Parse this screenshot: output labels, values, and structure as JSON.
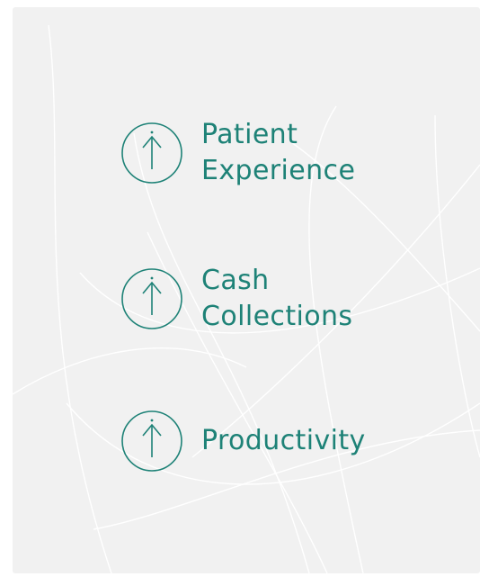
{
  "theme": {
    "accent": "#1e8277",
    "card_background": "#f1f1f1"
  },
  "metrics": [
    {
      "icon": "arrow-up-circle-icon",
      "label_lines": [
        "Patient",
        "Experience"
      ]
    },
    {
      "icon": "arrow-up-circle-icon",
      "label_lines": [
        "Cash",
        "Collections"
      ]
    },
    {
      "icon": "arrow-up-circle-icon",
      "label_lines": [
        "Productivity"
      ]
    }
  ]
}
